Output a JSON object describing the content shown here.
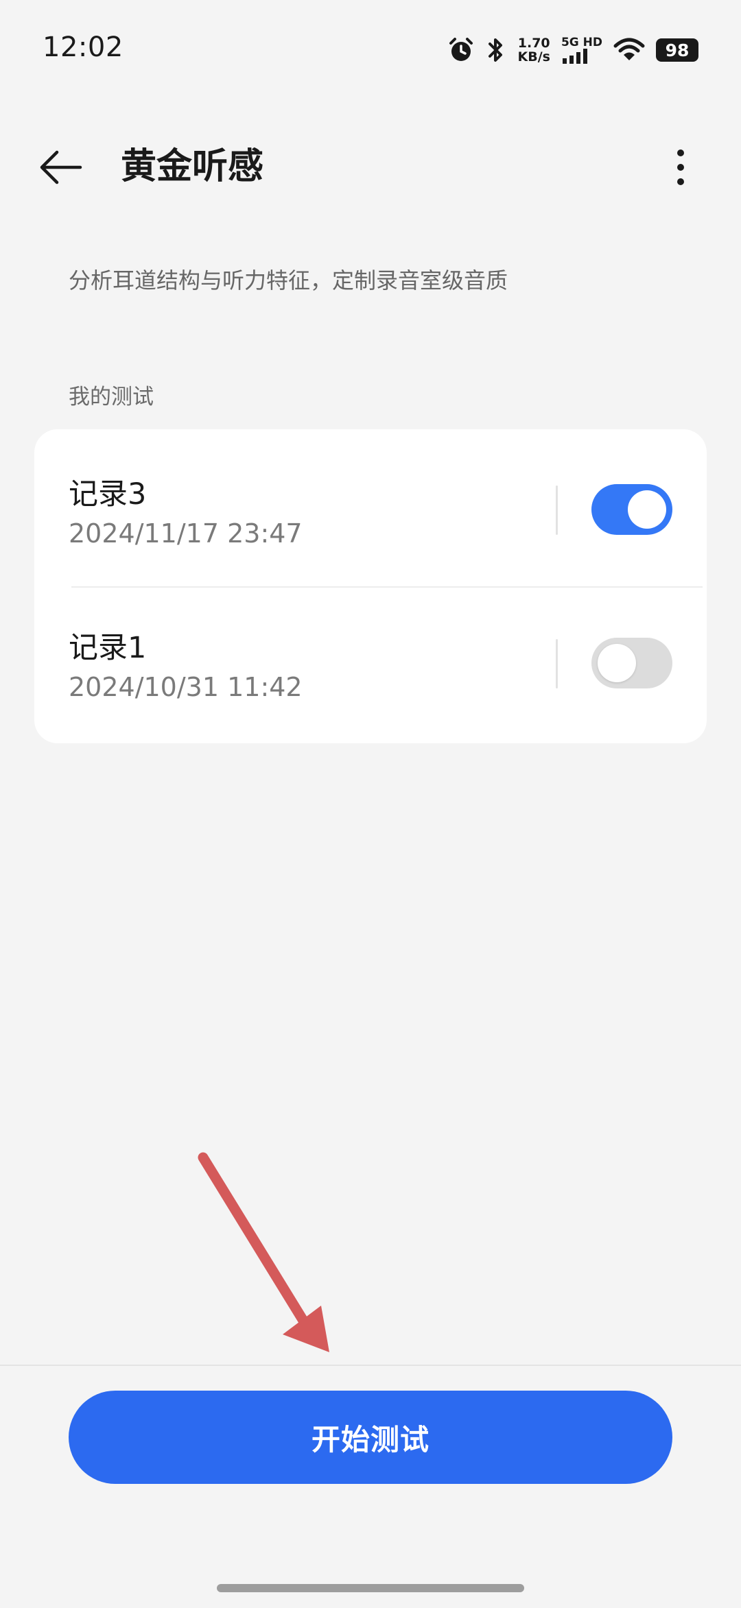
{
  "status_bar": {
    "time": "12:02",
    "speed_value": "1.70",
    "speed_unit": "KB/s",
    "network": "5G HD",
    "battery": "98"
  },
  "header": {
    "title": "黄金听感"
  },
  "description": "分析耳道结构与听力特征，定制录音室级音质",
  "section_label": "我的测试",
  "records": [
    {
      "title": "记录3",
      "date": "2024/11/17 23:47",
      "enabled": true
    },
    {
      "title": "记录1",
      "date": "2024/10/31 11:42",
      "enabled": false
    }
  ],
  "start_button": "开始测试",
  "colors": {
    "accent": "#2c6af0",
    "toggle_on": "#3478f6",
    "annotation_arrow": "#d45a5a"
  }
}
